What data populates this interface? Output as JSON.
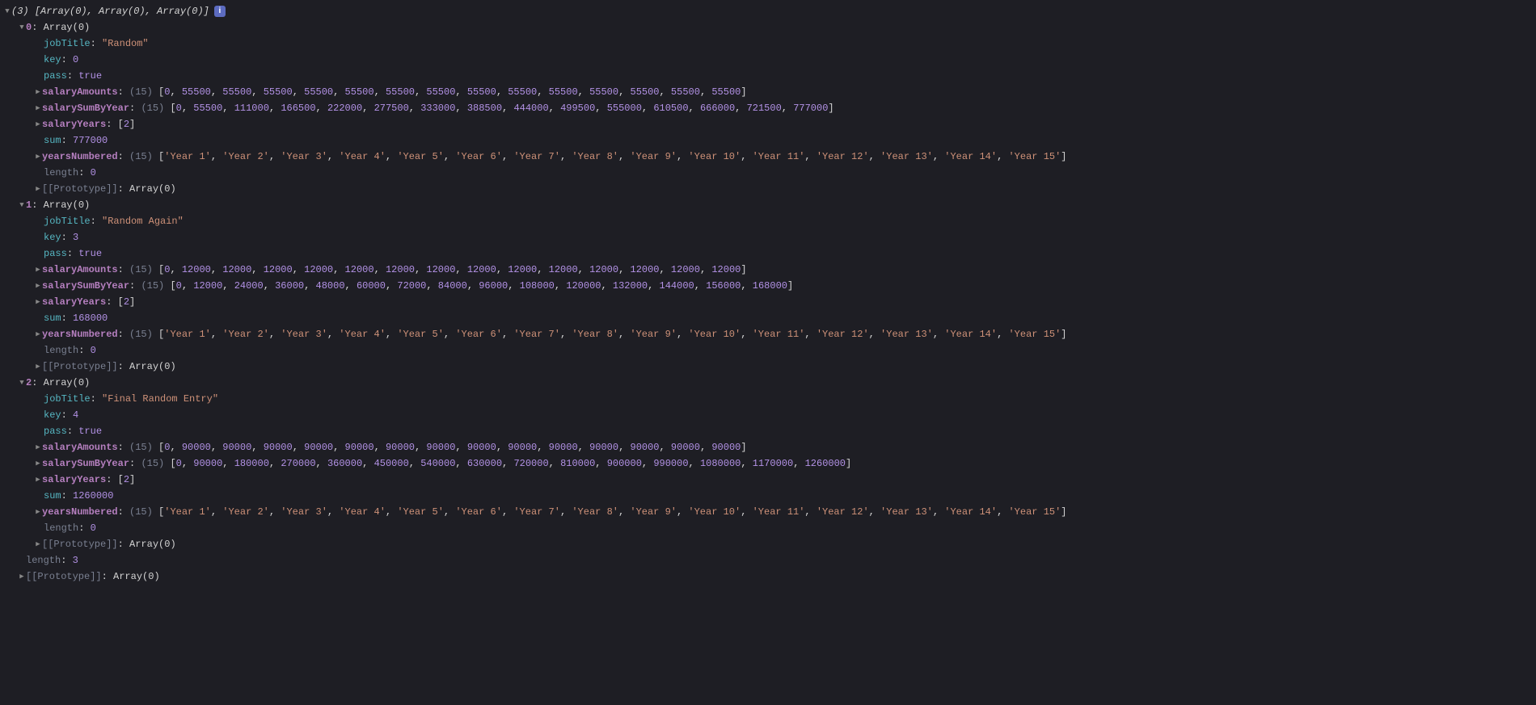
{
  "header": {
    "count": "(3)",
    "summary": "[Array(0), Array(0), Array(0)]",
    "info": "i"
  },
  "footer": {
    "length_label": "length",
    "length_val": "3",
    "proto_label": "[[Prototype]]",
    "proto_val": "Array(0)"
  },
  "entries": [
    {
      "idx": "0",
      "type": "Array(0)",
      "jobTitle_key": "jobTitle",
      "jobTitle_val": "\"Random\"",
      "key_key": "key",
      "key_val": "0",
      "pass_key": "pass",
      "pass_val": "true",
      "salaryAmounts_key": "salaryAmounts",
      "salaryAmounts_count": "(15)",
      "salaryAmounts_vals": "[0, 55500, 55500, 55500, 55500, 55500, 55500, 55500, 55500, 55500, 55500, 55500, 55500, 55500, 55500]",
      "salarySumByYear_key": "salarySumByYear",
      "salarySumByYear_count": "(15)",
      "salarySumByYear_vals": "[0, 55500, 111000, 166500, 222000, 277500, 333000, 388500, 444000, 499500, 555000, 610500, 666000, 721500, 777000]",
      "salaryYears_key": "salaryYears",
      "salaryYears_vals": "[2]",
      "sum_key": "sum",
      "sum_val": "777000",
      "yearsNumbered_key": "yearsNumbered",
      "yearsNumbered_count": "(15)",
      "yearsNumbered_vals": "['Year 1', 'Year 2', 'Year 3', 'Year 4', 'Year 5', 'Year 6', 'Year 7', 'Year 8', 'Year 9', 'Year 10', 'Year 11', 'Year 12', 'Year 13', 'Year 14', 'Year 15']",
      "length_label": "length",
      "length_val": "0",
      "proto_label": "[[Prototype]]",
      "proto_val": "Array(0)"
    },
    {
      "idx": "1",
      "type": "Array(0)",
      "jobTitle_key": "jobTitle",
      "jobTitle_val": "\"Random Again\"",
      "key_key": "key",
      "key_val": "3",
      "pass_key": "pass",
      "pass_val": "true",
      "salaryAmounts_key": "salaryAmounts",
      "salaryAmounts_count": "(15)",
      "salaryAmounts_vals": "[0, 12000, 12000, 12000, 12000, 12000, 12000, 12000, 12000, 12000, 12000, 12000, 12000, 12000, 12000]",
      "salarySumByYear_key": "salarySumByYear",
      "salarySumByYear_count": "(15)",
      "salarySumByYear_vals": "[0, 12000, 24000, 36000, 48000, 60000, 72000, 84000, 96000, 108000, 120000, 132000, 144000, 156000, 168000]",
      "salaryYears_key": "salaryYears",
      "salaryYears_vals": "[2]",
      "sum_key": "sum",
      "sum_val": "168000",
      "yearsNumbered_key": "yearsNumbered",
      "yearsNumbered_count": "(15)",
      "yearsNumbered_vals": "['Year 1', 'Year 2', 'Year 3', 'Year 4', 'Year 5', 'Year 6', 'Year 7', 'Year 8', 'Year 9', 'Year 10', 'Year 11', 'Year 12', 'Year 13', 'Year 14', 'Year 15']",
      "length_label": "length",
      "length_val": "0",
      "proto_label": "[[Prototype]]",
      "proto_val": "Array(0)"
    },
    {
      "idx": "2",
      "type": "Array(0)",
      "jobTitle_key": "jobTitle",
      "jobTitle_val": "\"Final Random Entry\"",
      "key_key": "key",
      "key_val": "4",
      "pass_key": "pass",
      "pass_val": "true",
      "salaryAmounts_key": "salaryAmounts",
      "salaryAmounts_count": "(15)",
      "salaryAmounts_vals": "[0, 90000, 90000, 90000, 90000, 90000, 90000, 90000, 90000, 90000, 90000, 90000, 90000, 90000, 90000]",
      "salarySumByYear_key": "salarySumByYear",
      "salarySumByYear_count": "(15)",
      "salarySumByYear_vals": "[0, 90000, 180000, 270000, 360000, 450000, 540000, 630000, 720000, 810000, 900000, 990000, 1080000, 1170000, 1260000]",
      "salaryYears_key": "salaryYears",
      "salaryYears_vals": "[2]",
      "sum_key": "sum",
      "sum_val": "1260000",
      "yearsNumbered_key": "yearsNumbered",
      "yearsNumbered_count": "(15)",
      "yearsNumbered_vals": "['Year 1', 'Year 2', 'Year 3', 'Year 4', 'Year 5', 'Year 6', 'Year 7', 'Year 8', 'Year 9', 'Year 10', 'Year 11', 'Year 12', 'Year 13', 'Year 14', 'Year 15']",
      "length_label": "length",
      "length_val": "0",
      "proto_label": "[[Prototype]]",
      "proto_val": "Array(0)"
    }
  ]
}
